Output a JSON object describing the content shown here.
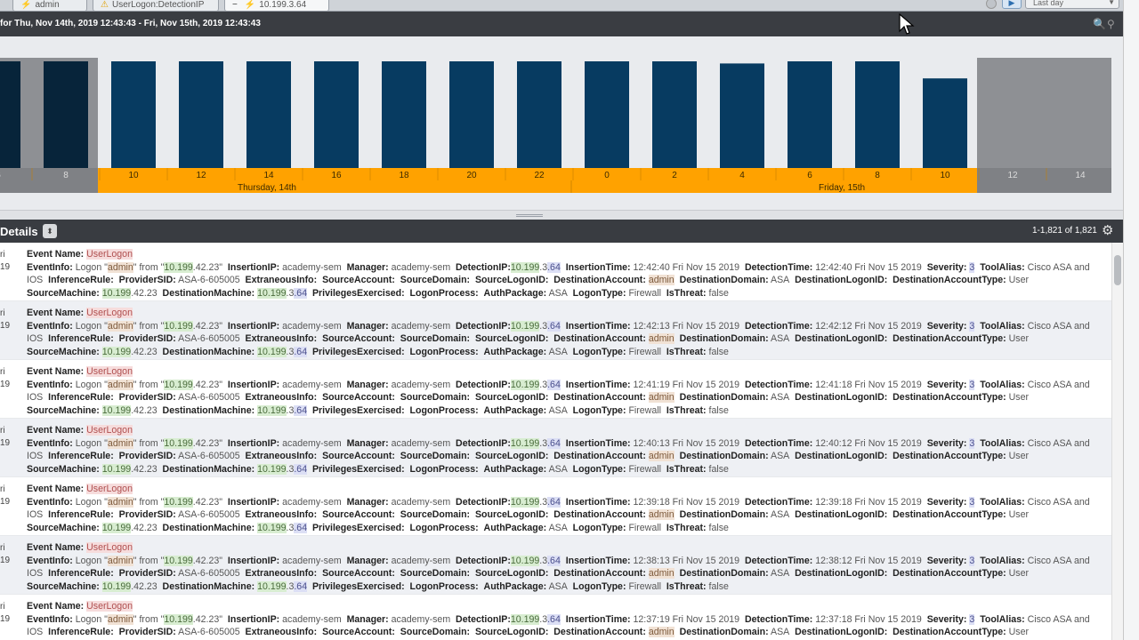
{
  "tabs": [
    {
      "label": "admin",
      "icon": "wand-icon"
    },
    {
      "label": "UserLogon:DetectionIP",
      "icon": "warning-icon"
    },
    {
      "label": "10.199.3.64",
      "icon": "wand-icon",
      "prefix": "−"
    }
  ],
  "toolbar": {
    "range_value": "Last day"
  },
  "header": {
    "title": "for Thu, Nov 14th, 2019 12:43:43 - Fri, Nov 15th, 2019 12:43:43"
  },
  "chart_data": {
    "type": "bar",
    "categories": [
      "6",
      "8",
      "10",
      "12",
      "14",
      "16",
      "18",
      "20",
      "22",
      "0",
      "2",
      "4",
      "6",
      "8",
      "10",
      "12",
      "14"
    ],
    "values": [
      1.0,
      1.0,
      1.0,
      1.0,
      1.0,
      1.0,
      1.0,
      1.0,
      1.0,
      1.0,
      1.0,
      0.98,
      1.0,
      1.0,
      0.84,
      null,
      null
    ],
    "day_labels": [
      "Thursday, 14th",
      "Friday, 15th"
    ],
    "ylim": [
      0,
      1.0
    ],
    "colors": {
      "bar": "#073b61",
      "bar_dark": "#07243a",
      "axis_active": "#ffa200",
      "axis_inactive": "#7f8185",
      "outside_window": "#8e9094"
    },
    "grid": false
  },
  "details": {
    "title": "Details",
    "count": "1-1,821 of 1,821"
  },
  "events": [
    {
      "date": "ri\n19",
      "insertion_time": "12:42:40 Fri Nov 15 2019",
      "detection_time": "12:42:40 Fri Nov 15 2019"
    },
    {
      "date": "ri\n19",
      "insertion_time": "12:42:13 Fri Nov 15 2019",
      "detection_time": "12:42:12 Fri Nov 15 2019"
    },
    {
      "date": "ri\n19",
      "insertion_time": "12:41:19 Fri Nov 15 2019",
      "detection_time": "12:41:18 Fri Nov 15 2019"
    },
    {
      "date": "ri\n19",
      "insertion_time": "12:40:13 Fri Nov 15 2019",
      "detection_time": "12:40:12 Fri Nov 15 2019"
    },
    {
      "date": "ri\n19",
      "insertion_time": "12:39:18 Fri Nov 15 2019",
      "detection_time": "12:39:18 Fri Nov 15 2019"
    },
    {
      "date": "ri\n19",
      "insertion_time": "12:38:13 Fri Nov 15 2019",
      "detection_time": "12:38:12 Fri Nov 15 2019"
    },
    {
      "date": "ri\n19",
      "insertion_time": "12:37:19 Fri Nov 15 2019",
      "detection_time": "12:37:18 Fri Nov 15 2019"
    }
  ],
  "event_common": {
    "event_name": "UserLogon",
    "info_prefix": "Logon \"",
    "user": "admin",
    "info_mid": "\" from \"",
    "src_ip_a": "10.199",
    "src_ip_b": ".42.23",
    "info_suffix": "\"",
    "insertion_ip": "academy-sem",
    "manager": "academy-sem",
    "det_ip_a": "10.199",
    "det_ip_b": ".3",
    "det_ip_c": ".64",
    "severity": "3",
    "tool_alias": "Cisco ASA and IOS",
    "provider_sid": "ASA-6-605005",
    "dest_domain": "ASA",
    "dest_account_type": "User",
    "source_machine_a": "10.199",
    "source_machine_b": ".42.23",
    "dest_machine_a": "10.199",
    "dest_machine_b": ".3",
    "dest_machine_c": ".64",
    "auth_package": "ASA",
    "logon_type": "Firewall",
    "is_threat": "false"
  },
  "labels": {
    "event_name": "Event Name:",
    "event_info": "EventInfo:",
    "insertion_ip": "InsertionIP:",
    "manager": "Manager:",
    "detection_ip": "DetectionIP:",
    "insertion_time": "InsertionTime:",
    "detection_time": "DetectionTime:",
    "severity": "Severity:",
    "tool_alias": "ToolAlias:",
    "inference_rule": "InferenceRule:",
    "provider_sid": "ProviderSID:",
    "extraneous_info": "ExtraneousInfo:",
    "source_account": "SourceAccount:",
    "source_domain": "SourceDomain:",
    "source_logon_id": "SourceLogonID:",
    "destination_account": "DestinationAccount:",
    "destination_domain": "DestinationDomain:",
    "destination_logon_id": "DestinationLogonID:",
    "destination_account_type": "DestinationAccountType:",
    "source_machine": "SourceMachine:",
    "destination_machine": "DestinationMachine:",
    "privileges_exercised": "PrivilegesExercised:",
    "logon_process": "LogonProcess:",
    "auth_package": "AuthPackage:",
    "logon_type": "LogonType:",
    "is_threat": "IsThreat:"
  }
}
